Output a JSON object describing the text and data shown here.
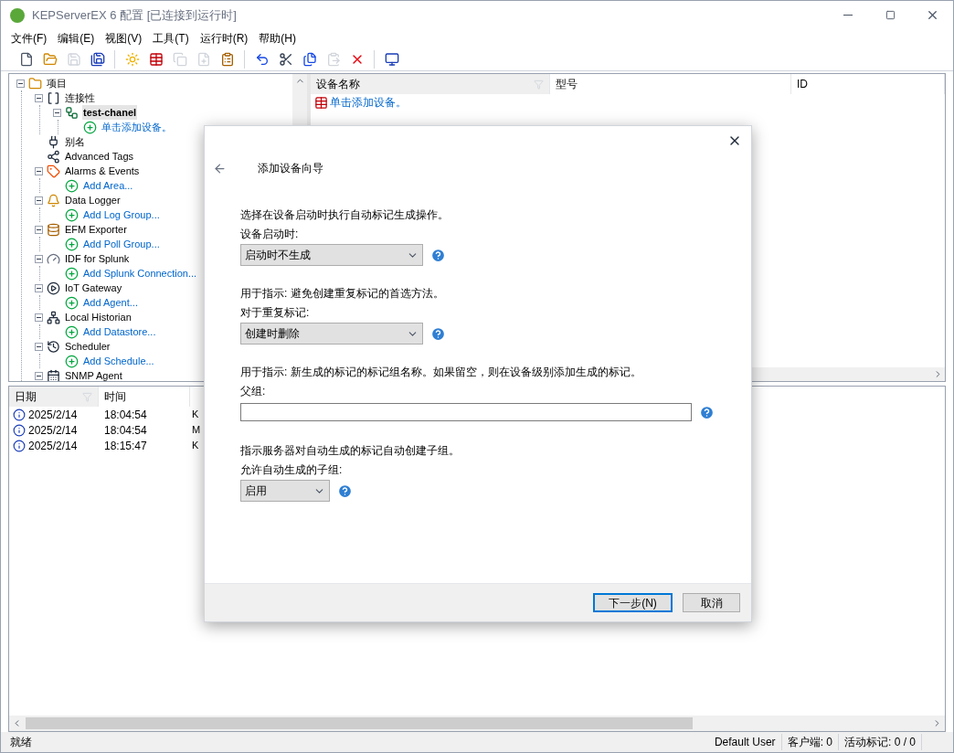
{
  "window": {
    "title": "KEPServerEX 6 配置 [已连接到运行时]"
  },
  "menu": [
    "文件(F)",
    "编辑(E)",
    "视图(V)",
    "工具(T)",
    "运行时(R)",
    "帮助(H)"
  ],
  "toolbar": [
    {
      "kind": "button",
      "disabled": false
    },
    {
      "kind": "button",
      "disabled": false
    },
    {
      "kind": "button",
      "disabled": true
    },
    {
      "kind": "button",
      "disabled": false
    },
    {
      "kind": "separator"
    },
    {
      "kind": "button",
      "disabled": false
    },
    {
      "kind": "button",
      "disabled": false
    },
    {
      "kind": "button",
      "disabled": true
    },
    {
      "kind": "button",
      "disabled": true
    },
    {
      "kind": "button",
      "disabled": false
    },
    {
      "kind": "separator"
    },
    {
      "kind": "button",
      "disabled": false
    },
    {
      "kind": "button",
      "disabled": false
    },
    {
      "kind": "button",
      "disabled": false
    },
    {
      "kind": "button",
      "disabled": true
    },
    {
      "kind": "button",
      "disabled": false
    },
    {
      "kind": "separator"
    },
    {
      "kind": "button",
      "disabled": false
    }
  ],
  "tree": [
    {
      "label": "项目",
      "kind": "node",
      "expanded": true,
      "selected": false,
      "children": [
        {
          "label": "连接性",
          "kind": "node",
          "expanded": true,
          "selected": false,
          "children": [
            {
              "label": "test-chanel",
              "kind": "node",
              "expanded": true,
              "selected": true,
              "children": [
                {
                  "label": "单击添加设备。",
                  "kind": "link",
                  "selected": false
                }
              ]
            }
          ]
        },
        {
          "label": "别名",
          "kind": "node",
          "selected": false
        },
        {
          "label": "Advanced Tags",
          "kind": "node",
          "selected": false
        },
        {
          "label": "Alarms & Events",
          "kind": "node",
          "expanded": true,
          "selected": false,
          "children": [
            {
              "label": "Add Area...",
              "kind": "link",
              "selected": false
            }
          ]
        },
        {
          "label": "Data Logger",
          "kind": "node",
          "expanded": true,
          "selected": false,
          "children": [
            {
              "label": "Add Log Group...",
              "kind": "link",
              "selected": false
            }
          ]
        },
        {
          "label": "EFM Exporter",
          "kind": "node",
          "expanded": true,
          "selected": false,
          "children": [
            {
              "label": "Add Poll Group...",
              "kind": "link",
              "selected": false
            }
          ]
        },
        {
          "label": "IDF for Splunk",
          "kind": "node",
          "expanded": true,
          "selected": false,
          "children": [
            {
              "label": "Add Splunk Connection...",
              "kind": "link",
              "selected": false
            }
          ]
        },
        {
          "label": "IoT Gateway",
          "kind": "node",
          "expanded": true,
          "selected": false,
          "children": [
            {
              "label": "Add Agent...",
              "kind": "link",
              "selected": false
            }
          ]
        },
        {
          "label": "Local Historian",
          "kind": "node",
          "expanded": true,
          "selected": false,
          "children": [
            {
              "label": "Add Datastore...",
              "kind": "link",
              "selected": false
            }
          ]
        },
        {
          "label": "Scheduler",
          "kind": "node",
          "expanded": true,
          "selected": false,
          "children": [
            {
              "label": "Add Schedule...",
              "kind": "link",
              "selected": false
            }
          ]
        },
        {
          "label": "SNMP Agent",
          "kind": "node",
          "expanded": true,
          "selected": false
        }
      ]
    }
  ],
  "device_table": {
    "columns": [
      {
        "label": "设备名称",
        "sorted": true
      },
      {
        "label": "型号",
        "sorted": false
      },
      {
        "label": "ID",
        "sorted": false
      }
    ],
    "add_link": "单击添加设备。"
  },
  "event_log": {
    "columns": [
      {
        "label": "日期",
        "sorted": true
      },
      {
        "label": "时间",
        "sorted": false
      }
    ],
    "rows": [
      {
        "date": "2025/2/14",
        "time": "18:04:54",
        "column_3": "K"
      },
      {
        "date": "2025/2/14",
        "time": "18:04:54",
        "column_3": "M"
      },
      {
        "date": "2025/2/14",
        "time": "18:15:47",
        "column_3": "K"
      }
    ]
  },
  "status_bar": {
    "text": "就绪",
    "user": "Default User",
    "clients": "客户端: 0",
    "active_tags": "活动标记: 0 / 0"
  },
  "dialog": {
    "title": "添加设备向导",
    "sections": [
      {
        "description": "选择在设备启动时执行自动标记生成操作。",
        "label": "设备启动时:",
        "field": {
          "kind": "select",
          "value": "启动时不生成"
        }
      },
      {
        "description": "用于指示: 避免创建重复标记的首选方法。",
        "label": "对于重复标记:",
        "field": {
          "kind": "select",
          "value": "创建时删除"
        }
      },
      {
        "description": "用于指示: 新生成的标记的标记组名称。如果留空，则在设备级别添加生成的标记。",
        "label": "父组:",
        "field": {
          "kind": "text"
        }
      },
      {
        "description": "指示服务器对自动生成的标记自动创建子组。",
        "label": "允许自动生成的子组:",
        "field": {
          "kind": "select",
          "value": "启用"
        }
      }
    ],
    "buttons": [
      {
        "label": "下一步(N)",
        "default": true
      },
      {
        "label": "取消",
        "default": false
      }
    ]
  }
}
